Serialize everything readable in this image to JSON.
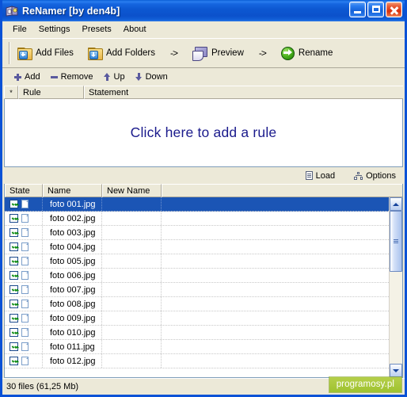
{
  "window": {
    "title": "ReNamer  [by den4b]",
    "icon": "app-icon",
    "buttons": {
      "minimize": "minimize",
      "maximize": "maximize",
      "close": "close"
    }
  },
  "menu": {
    "items": [
      {
        "label": "File"
      },
      {
        "label": "Settings"
      },
      {
        "label": "Presets"
      },
      {
        "label": "About"
      }
    ]
  },
  "toolbar": {
    "add_files": "Add Files",
    "add_folders": "Add Folders",
    "arrow1": "->",
    "preview": "Preview",
    "arrow2": "->",
    "rename": "Rename"
  },
  "rules": {
    "toolbar": {
      "add": "Add",
      "remove": "Remove",
      "up": "Up",
      "down": "Down"
    },
    "columns": [
      {
        "label": "*"
      },
      {
        "label": "Rule"
      },
      {
        "label": "Statement"
      }
    ],
    "empty_hint": "Click here to add a rule",
    "hint_color": "#1a1a8c"
  },
  "files": {
    "actions": {
      "load": "Load",
      "options": "Options"
    },
    "columns": [
      {
        "label": "State"
      },
      {
        "label": "Name"
      },
      {
        "label": "New Name"
      }
    ],
    "rows": [
      {
        "checked": true,
        "name": "foto 001.jpg",
        "new_name": "",
        "selected": true
      },
      {
        "checked": true,
        "name": "foto 002.jpg",
        "new_name": "",
        "selected": false
      },
      {
        "checked": true,
        "name": "foto 003.jpg",
        "new_name": "",
        "selected": false
      },
      {
        "checked": true,
        "name": "foto 004.jpg",
        "new_name": "",
        "selected": false
      },
      {
        "checked": true,
        "name": "foto 005.jpg",
        "new_name": "",
        "selected": false
      },
      {
        "checked": true,
        "name": "foto 006.jpg",
        "new_name": "",
        "selected": false
      },
      {
        "checked": true,
        "name": "foto 007.jpg",
        "new_name": "",
        "selected": false
      },
      {
        "checked": true,
        "name": "foto 008.jpg",
        "new_name": "",
        "selected": false
      },
      {
        "checked": true,
        "name": "foto 009.jpg",
        "new_name": "",
        "selected": false
      },
      {
        "checked": true,
        "name": "foto 010.jpg",
        "new_name": "",
        "selected": false
      },
      {
        "checked": true,
        "name": "foto 011.jpg",
        "new_name": "",
        "selected": false
      },
      {
        "checked": true,
        "name": "foto 012.jpg",
        "new_name": "",
        "selected": false
      }
    ],
    "scrollbar": {
      "thumb_top_pct": 0,
      "thumb_height_pct": 40
    }
  },
  "status": {
    "text": "30 files (61,25 Mb)"
  },
  "watermark": {
    "text": "programosy.pl",
    "bg": "#a9c93a",
    "fg": "#ffffff"
  },
  "colors": {
    "title_bar": "#0d58d2",
    "window_bg": "#ece9d8",
    "selection": "#1b55b5",
    "border": "#7f9db9"
  }
}
